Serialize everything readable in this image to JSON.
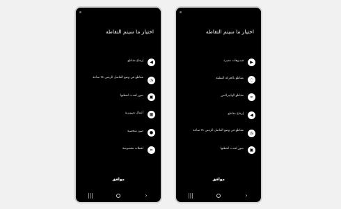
{
  "left": {
    "title": "اختيار ما سيتم التقاطه",
    "options": [
      {
        "label": "إرجاع مقاطع",
        "icon": "rewind-icon",
        "glyph": "◀"
      },
      {
        "label": "مقاطع في وضع الفاصل الزمني ٢٤ ساعة",
        "icon": "timer-icon",
        "glyph": "◷"
      },
      {
        "label": "صور لحدث لحظتها",
        "icon": "image-icon",
        "glyph": "▣"
      },
      {
        "label": "أعمال تصويرية",
        "icon": "gallery-icon",
        "glyph": "▦"
      },
      {
        "label": "صور شخصية",
        "icon": "person-icon",
        "glyph": "●"
      },
      {
        "label": "لقطات مقصوصة",
        "icon": "crop-icon",
        "glyph": "⌗"
      }
    ],
    "ok_label": "موافق"
  },
  "right": {
    "title": "اختيار ما سيتم التقاطه",
    "options": [
      {
        "label": "فيديوهات مميزة",
        "icon": "play-icon",
        "glyph": "▶"
      },
      {
        "label": "مقاطع بالحركة البطيئة",
        "icon": "slow-motion-icon",
        "glyph": "◌"
      },
      {
        "label": "مقاطع الهايبرلابس",
        "icon": "hyperlapse-icon",
        "glyph": "∞"
      },
      {
        "label": "إرجاع مقاطع",
        "icon": "rewind-icon",
        "glyph": "◀"
      },
      {
        "label": "مقاطع في وضع الفاصل الزمني ٢٤ ساعة",
        "icon": "timer-icon",
        "glyph": "◷"
      },
      {
        "label": "صور لحدث لحظتها",
        "icon": "image-icon",
        "glyph": "▣"
      }
    ],
    "ok_label": "موافق"
  },
  "nav": {
    "recents": "|||",
    "back": "›"
  }
}
